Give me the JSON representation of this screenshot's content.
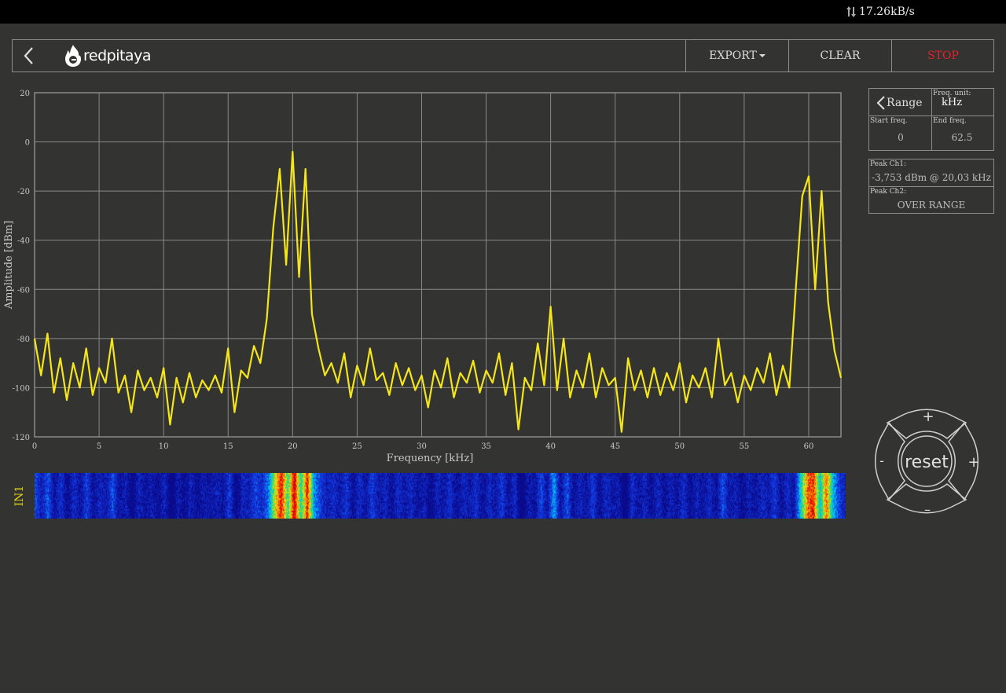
{
  "status": {
    "rate": "17.26kB/s"
  },
  "header": {
    "logo_text": "redpitaya",
    "export_label": "EXPORT",
    "clear_label": "CLEAR",
    "stop_label": "STOP"
  },
  "chart_data": {
    "type": "line",
    "xlabel": "Frequency   [kHz]",
    "ylabel": "Amplitude  [dBm]",
    "xlim": [
      0,
      62.5
    ],
    "ylim": [
      -120,
      20
    ],
    "xticks": [
      "0",
      "5",
      "10",
      "15",
      "20",
      "25",
      "30",
      "35",
      "40",
      "45",
      "50",
      "55",
      "60"
    ],
    "yticks": [
      "20",
      "0",
      "-20",
      "-40",
      "-60",
      "-80",
      "-100",
      "-120"
    ],
    "grid": true,
    "series": [
      {
        "color": "#f5e61a",
        "x": [
          0,
          0.5,
          1,
          1.5,
          2,
          2.5,
          3,
          3.5,
          4,
          4.5,
          5,
          5.5,
          6,
          6.5,
          7,
          7.5,
          8,
          8.5,
          9,
          9.5,
          10,
          10.5,
          11,
          11.5,
          12,
          12.5,
          13,
          13.5,
          14,
          14.5,
          15,
          15.5,
          16,
          16.5,
          17,
          17.5,
          18,
          18.5,
          19,
          19.5,
          20,
          20.5,
          21,
          21.5,
          22,
          22.5,
          23,
          23.5,
          24,
          24.5,
          25,
          25.5,
          26,
          26.5,
          27,
          27.5,
          28,
          28.5,
          29,
          29.5,
          30,
          30.5,
          31,
          31.5,
          32,
          32.5,
          33,
          33.5,
          34,
          34.5,
          35,
          35.5,
          36,
          36.5,
          37,
          37.5,
          38,
          38.5,
          39,
          39.5,
          40,
          40.5,
          41,
          41.5,
          42,
          42.5,
          43,
          43.5,
          44,
          44.5,
          45,
          45.5,
          46,
          46.5,
          47,
          47.5,
          48,
          48.5,
          49,
          49.5,
          50,
          50.5,
          51,
          51.5,
          52,
          52.5,
          53,
          53.5,
          54,
          54.5,
          55,
          55.5,
          56,
          56.5,
          57,
          57.5,
          58,
          58.5,
          59,
          59.5,
          60,
          60.5,
          61,
          61.5,
          62,
          62.5
        ],
        "y": [
          -80,
          -95,
          -78,
          -102,
          -88,
          -105,
          -90,
          -100,
          -84,
          -103,
          -92,
          -98,
          -80,
          -102,
          -95,
          -110,
          -93,
          -101,
          -96,
          -104,
          -92,
          -115,
          -96,
          -106,
          -94,
          -104,
          -97,
          -101,
          -95,
          -102,
          -84,
          -110,
          -93,
          -96,
          -83,
          -90,
          -72,
          -35,
          -11,
          -50,
          -4,
          -55,
          -11,
          -70,
          -84,
          -95,
          -90,
          -98,
          -86,
          -104,
          -91,
          -99,
          -84,
          -97,
          -94,
          -103,
          -90,
          -99,
          -92,
          -101,
          -95,
          -108,
          -93,
          -100,
          -88,
          -104,
          -94,
          -98,
          -89,
          -102,
          -93,
          -98,
          -86,
          -103,
          -90,
          -117,
          -96,
          -101,
          -82,
          -99,
          -67,
          -101,
          -80,
          -104,
          -93,
          -100,
          -86,
          -104,
          -92,
          -99,
          -96,
          -118,
          -88,
          -101,
          -93,
          -104,
          -92,
          -103,
          -94,
          -101,
          -90,
          -106,
          -95,
          -100,
          -92,
          -104,
          -80,
          -99,
          -94,
          -106,
          -95,
          -101,
          -92,
          -98,
          -86,
          -103,
          -91,
          -100,
          -60,
          -22,
          -14,
          -60,
          -20,
          -65,
          -85,
          -96
        ]
      }
    ]
  },
  "panel": {
    "range_label": "Range",
    "freq_unit_label": "Freq.  unit:",
    "freq_unit_value": "kHz",
    "start_freq_label": "Start  freq.",
    "start_freq_value": "0",
    "end_freq_label": "End  freq.",
    "end_freq_value": "62.5",
    "peak1_label": "Peak  Ch1:",
    "peak1_value": "-3,753  dBm  @ 20,03  kHz",
    "peak2_label": "Peak  Ch2:",
    "peak2_value": "OVER RANGE"
  },
  "waterfall": {
    "channel_label": "IN1"
  },
  "dpad": {
    "reset_label": "reset",
    "plus": "+",
    "minus": "-",
    "minus_bottom": "–"
  }
}
